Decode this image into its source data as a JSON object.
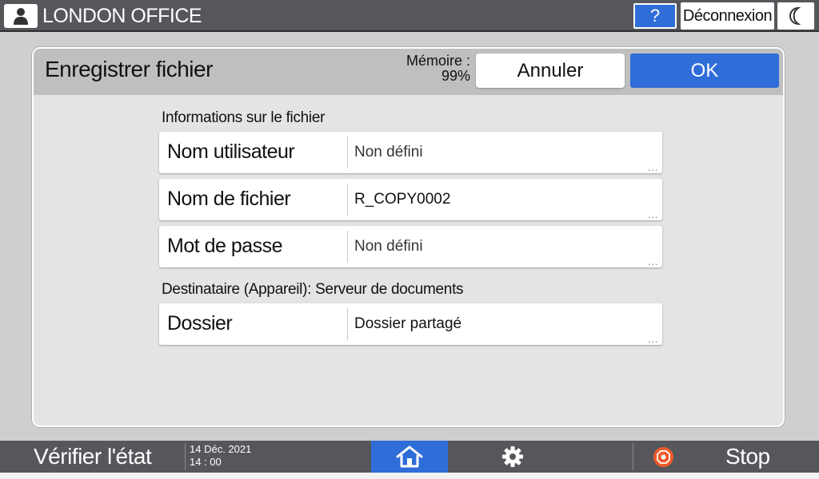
{
  "topbar": {
    "user_icon": "user-icon",
    "office_name": "LONDON OFFICE",
    "help_label": "?",
    "logout_label": "Déconnexion",
    "sleep_icon": "moon-icon"
  },
  "dialog": {
    "title": "Enregistrer fichier",
    "memory_label": "Mémoire :",
    "memory_value": "99%",
    "cancel_label": "Annuler",
    "ok_label": "OK",
    "section_file_info": "Informations sur le fichier",
    "fields": [
      {
        "label": "Nom utilisateur",
        "value": "Non défini"
      },
      {
        "label": "Nom de fichier",
        "value": "R_COPY0002"
      },
      {
        "label": "Mot de passe",
        "value": "Non défini"
      }
    ],
    "section_destination": "Destinataire (Appareil): Serveur de documents",
    "folder_field": {
      "label": "Dossier",
      "value": "Dossier partagé"
    },
    "more_indicator": "..."
  },
  "bottombar": {
    "status_label": "Vérifier l'état",
    "date": "14 Déc. 2021",
    "time": "14 : 00",
    "home_icon": "home-icon",
    "settings_icon": "gear-icon",
    "stop_icon": "stop-icon",
    "stop_label": "Stop"
  },
  "colors": {
    "bar_background": "#55575b",
    "accent_blue": "#2f6dd8",
    "dialog_background": "#e4e4e4",
    "dialog_header": "#bfbfbf",
    "stop_orange": "#f05a28"
  }
}
